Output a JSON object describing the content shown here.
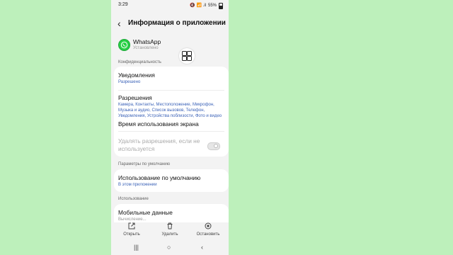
{
  "status": {
    "time": "3:29",
    "small_icons": "◆ ⌕ ·",
    "right_icons": "🔇 📶 .il",
    "battery_text": "55%"
  },
  "header": {
    "back_glyph": "‹",
    "title": "Информация о приложении"
  },
  "app": {
    "name": "WhatsApp",
    "status": "Установлено"
  },
  "sections": {
    "privacy": "Конфиденциальность",
    "defaults": "Параметры по умолчанию",
    "usage": "Использование"
  },
  "rows": {
    "notifications": {
      "title": "Уведомления",
      "sub": "Разрешено"
    },
    "permissions": {
      "title": "Разрешения",
      "sub": "Камера, Контакты, Местоположение, Микрофон, Музыка и аудио, Список вызовов, Телефон, Уведомления, Устройства поблизости, Фото и видео и SMS"
    },
    "screen_time": {
      "title": "Время использования экрана"
    },
    "remove_permissions": {
      "title": "Удалять разрешения, если не используется"
    },
    "default_usage": {
      "title": "Использование по умолчанию",
      "sub": "В этом приложении"
    },
    "mobile_data": {
      "title": "Мобильные данные",
      "sub": "Вычисление..."
    }
  },
  "actions": {
    "open": {
      "label": "Открыть",
      "icon": "open-external-icon"
    },
    "delete": {
      "label": "Удалить",
      "icon": "trash-icon"
    },
    "stop": {
      "label": "Остановить",
      "icon": "stop-icon"
    }
  },
  "nav": {
    "recent": "|||",
    "home": "○",
    "back": "‹"
  },
  "colors": {
    "background": "#bdf0bb",
    "accent_blue": "#3c63b8",
    "whatsapp_green": "#27d045"
  }
}
